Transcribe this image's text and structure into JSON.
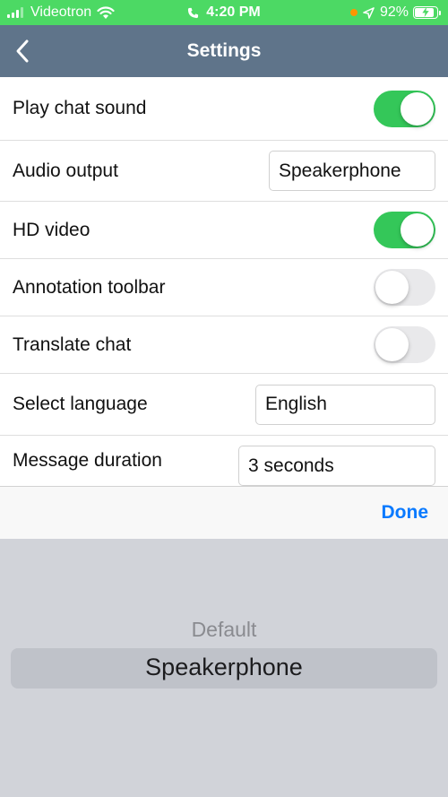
{
  "status_bar": {
    "carrier": "Videotron",
    "time": "4:20 PM",
    "battery_percent": "92%",
    "battery_level": 0.92,
    "background_color": "#4cd964"
  },
  "nav": {
    "title": "Settings",
    "back_icon": "chevron-left-icon",
    "background_color": "#5f748a"
  },
  "settings": {
    "play_chat_sound": {
      "label": "Play chat sound",
      "on": true
    },
    "audio_output": {
      "label": "Audio output",
      "value": "Speakerphone"
    },
    "hd_video": {
      "label": "HD video",
      "on": true
    },
    "annotation_toolbar": {
      "label": "Annotation toolbar",
      "on": false
    },
    "translate_chat": {
      "label": "Translate chat",
      "on": false
    },
    "select_language": {
      "label": "Select language",
      "value": "English"
    },
    "message_duration": {
      "label": "Message duration",
      "value": "3 seconds"
    }
  },
  "picker": {
    "done_label": "Done",
    "options": [
      "Default",
      "Speakerphone"
    ],
    "selected": "Speakerphone",
    "accent_color": "#0a7aff",
    "toggle_on_color": "#34c759"
  }
}
